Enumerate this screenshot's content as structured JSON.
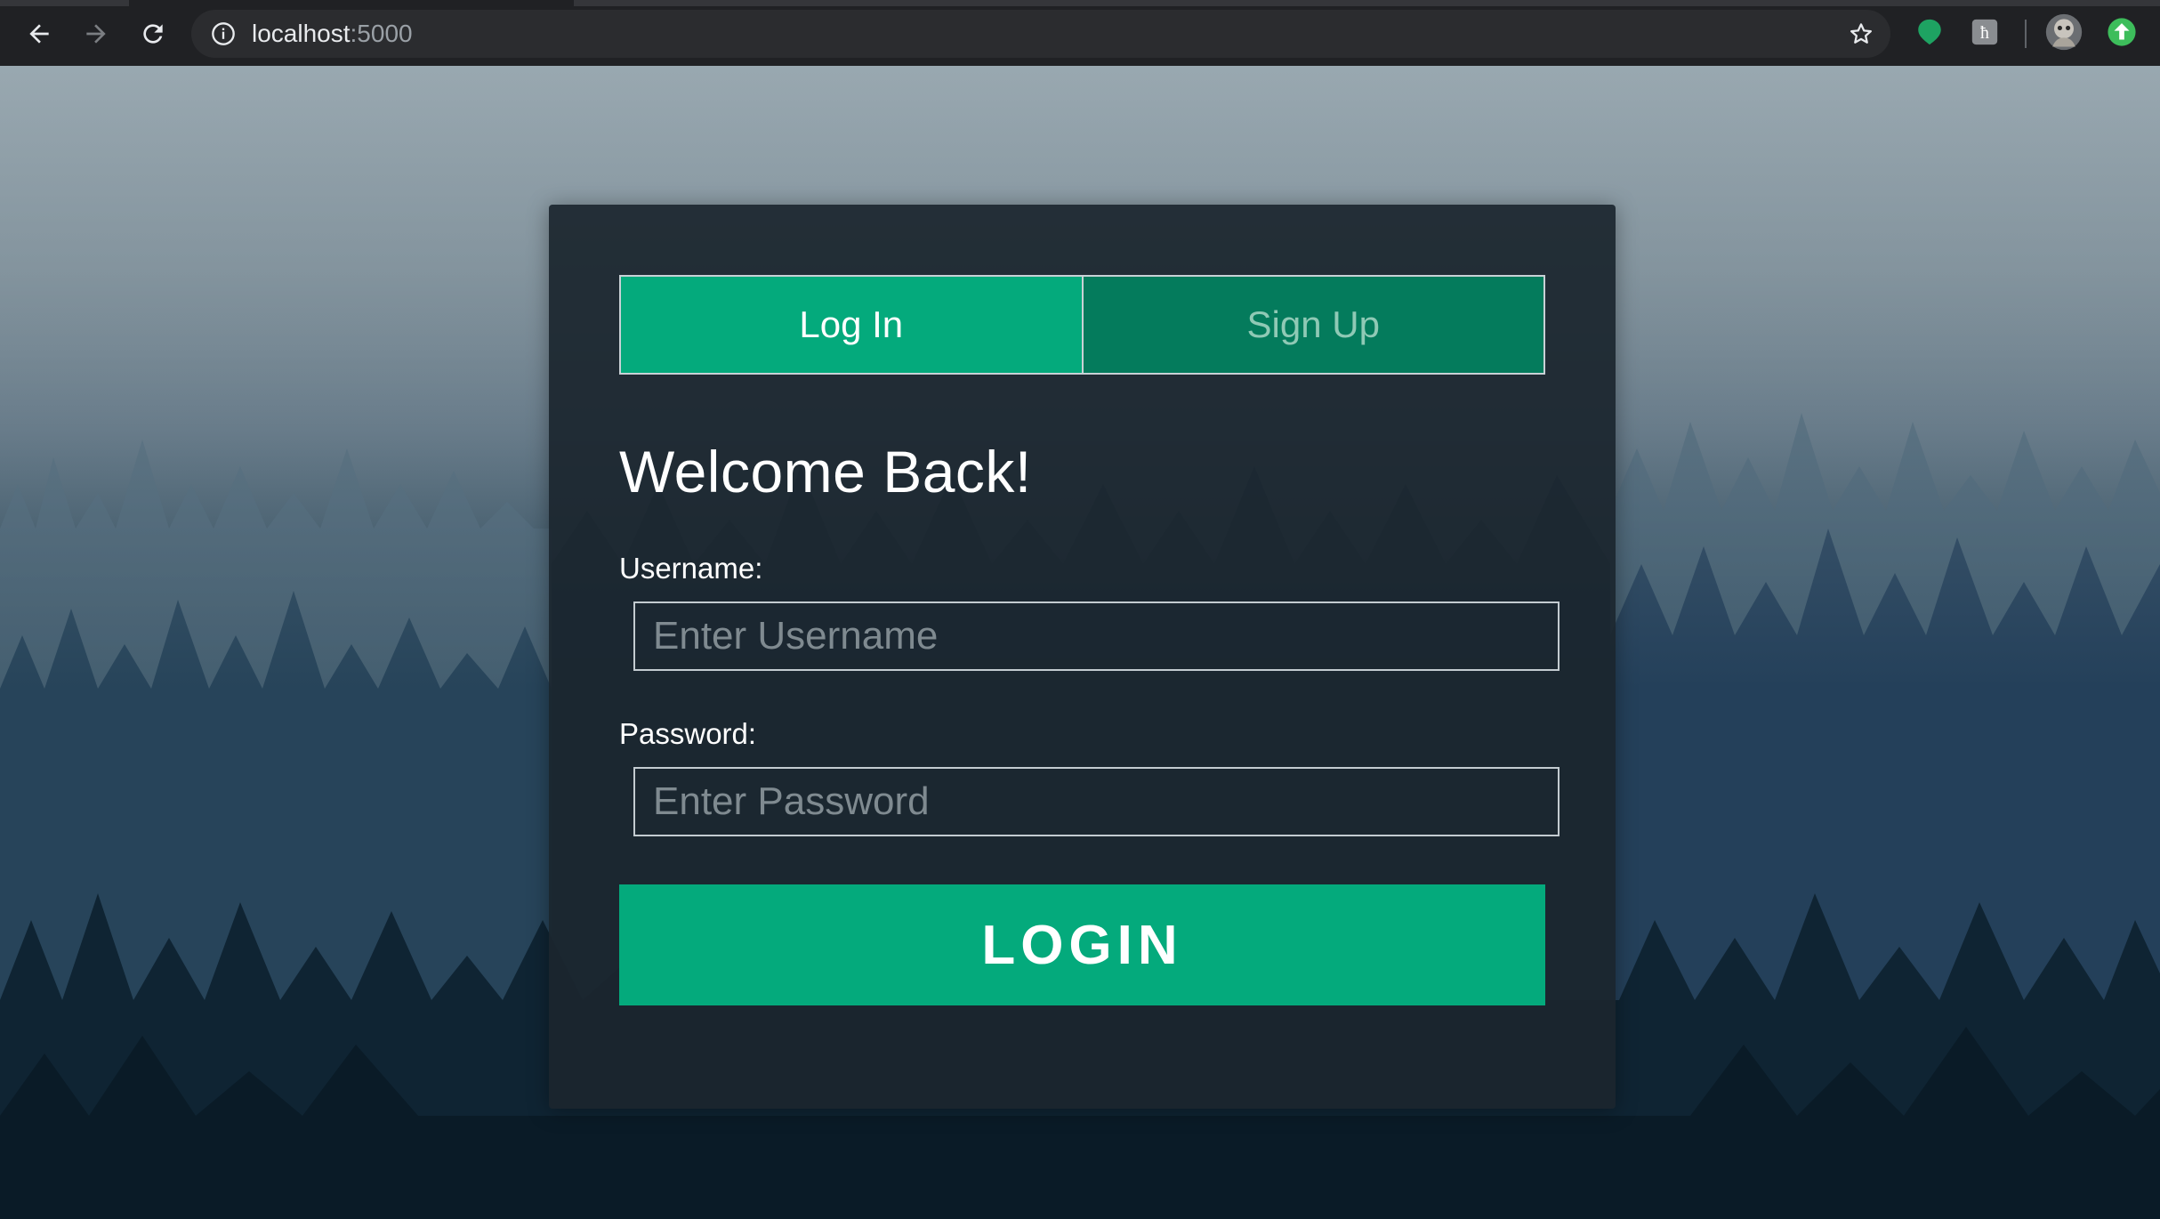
{
  "browser": {
    "url_host": "localhost",
    "url_port": ":5000"
  },
  "tabs": {
    "login": "Log In",
    "signup": "Sign Up"
  },
  "form": {
    "heading": "Welcome Back!",
    "username_label": "Username:",
    "username_placeholder": "Enter Username",
    "password_label": "Password:",
    "password_placeholder": "Enter Password",
    "submit": "LOGIN"
  },
  "colors": {
    "accent": "#04aa7c",
    "accent_dark": "#047b5c",
    "card": "#1b262e"
  }
}
